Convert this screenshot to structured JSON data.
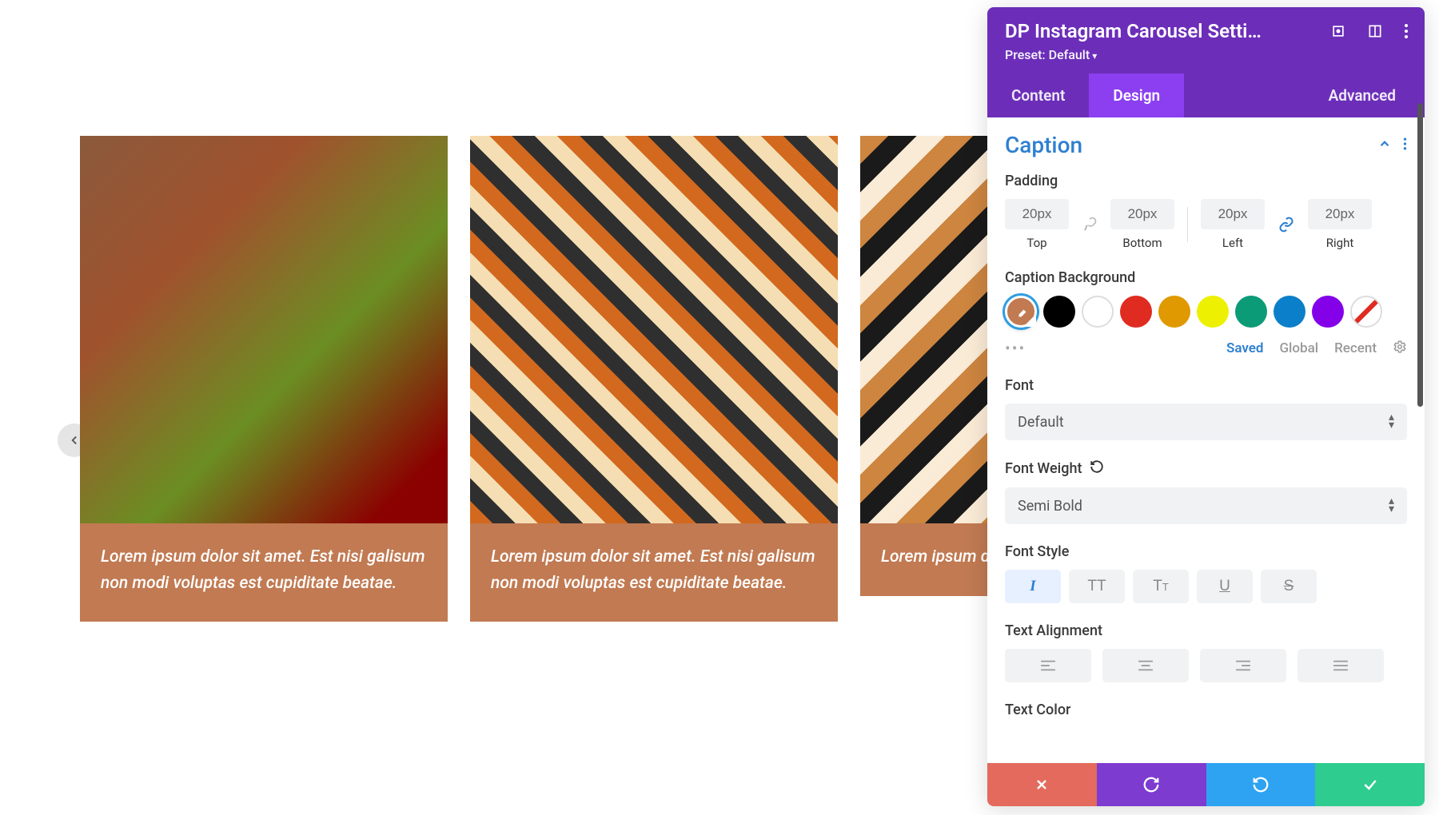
{
  "carousel": {
    "cards": [
      {
        "caption": "Lorem ipsum dolor sit amet. Est nisi galisum non modi voluptas est cupiditate beatae."
      },
      {
        "caption": "Lorem ipsum dolor sit amet. Est nisi galisum non modi voluptas est cupiditate beatae."
      },
      {
        "caption": "Lorem ipsum dolor sit amet. Est nisi galisum non modi voluptas est cupiditate beatae."
      }
    ]
  },
  "panel": {
    "title": "DP Instagram Carousel Setti…",
    "preset_label": "Preset: Default",
    "tabs": {
      "content": "Content",
      "design": "Design",
      "advanced": "Advanced",
      "active": "design"
    },
    "section": {
      "title": "Caption",
      "padding_label": "Padding",
      "padding": {
        "top": {
          "value": "20px",
          "label": "Top"
        },
        "bottom": {
          "value": "20px",
          "label": "Bottom"
        },
        "left": {
          "value": "20px",
          "label": "Left"
        },
        "right": {
          "value": "20px",
          "label": "Right"
        }
      },
      "link_left_active": false,
      "link_right_active": true,
      "bg_label": "Caption Background",
      "color_picker_value": "#c17a52",
      "color_tabs": {
        "saved": "Saved",
        "global": "Global",
        "recent": "Recent"
      },
      "font_label": "Font",
      "font_value": "Default",
      "font_weight_label": "Font Weight",
      "font_weight_value": "Semi Bold",
      "font_style_label": "Font Style",
      "font_style_active": "italic",
      "text_align_label": "Text Alignment",
      "text_color_label": "Text Color"
    }
  }
}
